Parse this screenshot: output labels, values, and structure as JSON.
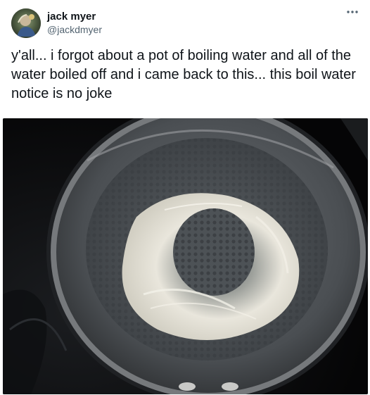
{
  "tweet": {
    "author": {
      "name": "jack myer",
      "handle": "@jackdmyer"
    },
    "more_icon": "ellipsis-icon",
    "text": "y'all... i forgot about a pot of boiling water and all of the water boiled off and i came back to this... this boil water notice is no joke",
    "photo_icon": "pot-photo"
  },
  "colors": {
    "text": "#0f1419",
    "muted": "#536471",
    "background": "#ffffff"
  }
}
